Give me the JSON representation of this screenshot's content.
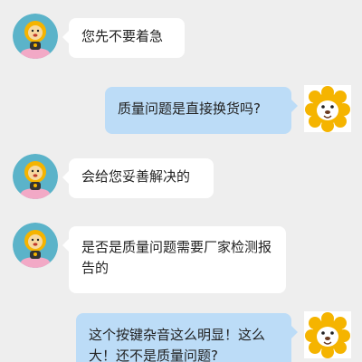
{
  "conversation": {
    "messages": [
      {
        "sender": "agent",
        "text": "您先不要着急"
      },
      {
        "sender": "user",
        "text": "质量问题是直接换货吗?"
      },
      {
        "sender": "agent",
        "text": "会给您妥善解决的"
      },
      {
        "sender": "agent",
        "text": "是否是质量问题需要厂家检测报告的"
      },
      {
        "sender": "user",
        "text": "这个按键杂音这么明显！这么大！还不是质量问题?"
      }
    ]
  },
  "colors": {
    "background": "#eeeeee",
    "agent_bubble": "#ffffff",
    "user_bubble": "#bcdcf7",
    "agent_avatar_bg": "#5bb3c9",
    "lion_mane": "#f5b400"
  },
  "icons": {
    "agent_avatar": "lion-mascot-icon",
    "user_avatar": "lion-face-icon"
  }
}
